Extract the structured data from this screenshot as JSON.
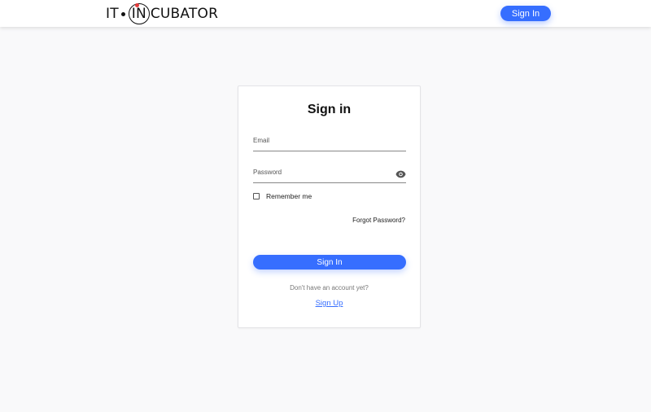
{
  "header": {
    "logo_prefix": "IT",
    "logo_circle_text": "IN",
    "logo_suffix": "CUBATOR",
    "signin_label": "Sign In"
  },
  "card": {
    "title": "Sign in",
    "email_label": "Email",
    "password_label": "Password",
    "remember_label": "Remember me",
    "remember_checked": false,
    "forgot_label": "Forgot Password?",
    "signin_label": "Sign In",
    "no_account_text": "Don't have an account yet?",
    "signup_label": "Sign Up"
  },
  "colors": {
    "accent": "#366eff",
    "background": "#f9f9fa",
    "logo_dot": "#e23a3a"
  },
  "icons": {
    "password_toggle": "eye-icon"
  }
}
